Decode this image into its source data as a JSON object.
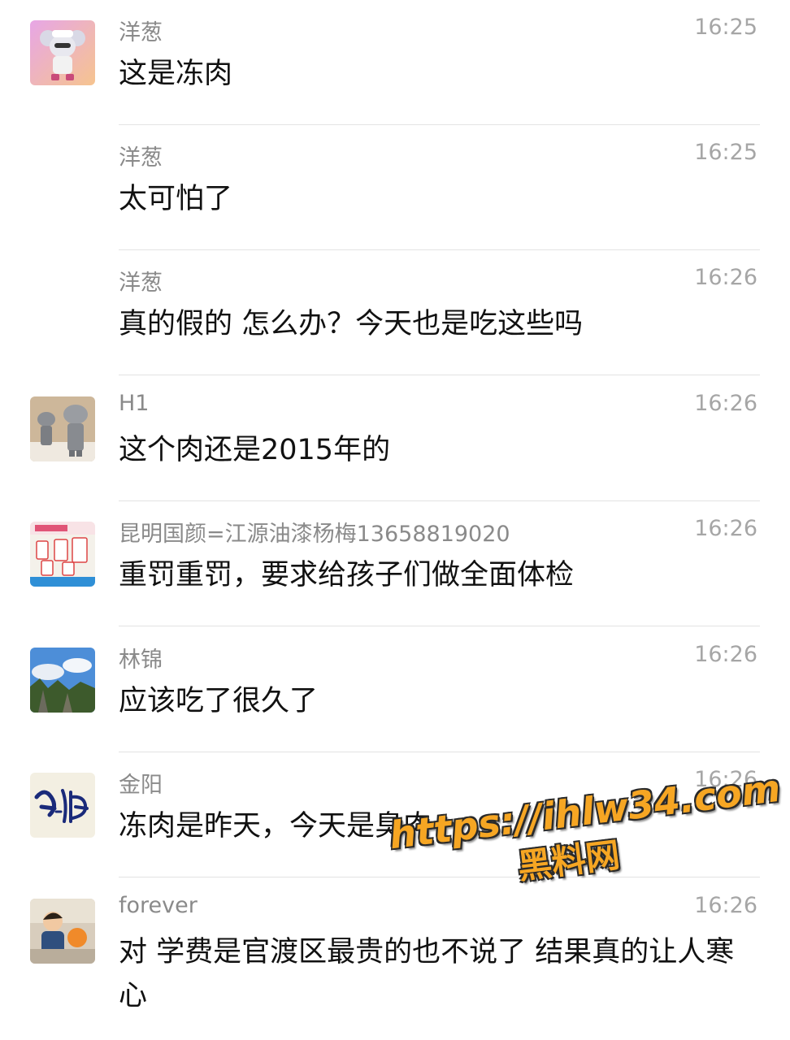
{
  "messages": [
    {
      "name": "洋葱",
      "time": "16:25",
      "text": "这是冻肉",
      "avatar": "mouse-avatar",
      "show_avatar": true
    },
    {
      "name": "洋葱",
      "time": "16:25",
      "text": "太可怕了",
      "avatar": "",
      "show_avatar": false
    },
    {
      "name": "洋葱",
      "time": "16:26",
      "text": "真的假的  怎么办？今天也是吃这些吗",
      "avatar": "",
      "show_avatar": false
    },
    {
      "name": "H1",
      "time": "16:26",
      "text": "这个肉还是2015年的",
      "avatar": "figure-toys-avatar",
      "show_avatar": true
    },
    {
      "name": "昆明国颜=江源油漆杨梅13658819020",
      "time": "16:26",
      "text": "重罚重罚，要求给孩子们做全面体检",
      "avatar": "paint-cans-avatar",
      "show_avatar": true
    },
    {
      "name": "林锦",
      "time": "16:26",
      "text": "应该吃了很久了",
      "avatar": "sky-landscape-avatar",
      "show_avatar": true
    },
    {
      "name": "金阳",
      "time": "16:26",
      "text": "冻肉是昨天，今天是臭肉",
      "avatar": "calligraphy-avatar",
      "show_avatar": true
    },
    {
      "name": "forever",
      "time": "16:26",
      "text": "对  学费是官渡区最贵的也不说了  结果真的让人寒心",
      "avatar": "child-balloon-avatar",
      "show_avatar": true
    }
  ],
  "watermark": {
    "url": "https://ihlw34.com",
    "site": "黑料网"
  },
  "colors": {
    "name": "#8a8a8a",
    "time": "#a6a6a6",
    "text": "#111111",
    "separator": "#e3e3e3",
    "watermark": "#f6a623"
  }
}
